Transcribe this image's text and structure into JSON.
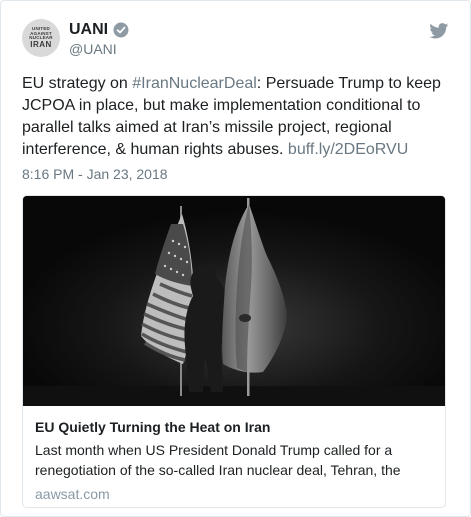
{
  "account": {
    "display_name": "UANI",
    "handle": "@UANI",
    "avatar_lines": [
      "UNITED",
      "AGAINST",
      "NUCLEAR",
      "IRAN"
    ],
    "verified": true
  },
  "tweet": {
    "text_parts": [
      {
        "text": "EU strategy on ",
        "link": false
      },
      {
        "text": "#IranNuclearDeal",
        "link": true
      },
      {
        "text": ": Persuade Trump to keep JCPOA in place, but make implementation conditional to parallel talks aimed at Iran’s missile project, regional interference, & human rights abuses. ",
        "link": false
      },
      {
        "text": "buff.ly/2DEoRVU",
        "link": true
      }
    ],
    "timestamp": "8:16 PM - Jan 23, 2018"
  },
  "card": {
    "title": "EU Quietly Turning the Heat on Iran",
    "description": "Last month when US President Donald Trump called for a renegotiation of the so-called Iran nuclear deal, Tehran, the",
    "domain": "aawsat.com"
  },
  "colors": {
    "text": "#1c2022",
    "secondary": "#697882",
    "border": "#e1e8ed",
    "twitter_icon": "#8e9ba5"
  },
  "icons": {
    "verified": "verified-badge-icon",
    "platform": "twitter-bird-icon"
  }
}
